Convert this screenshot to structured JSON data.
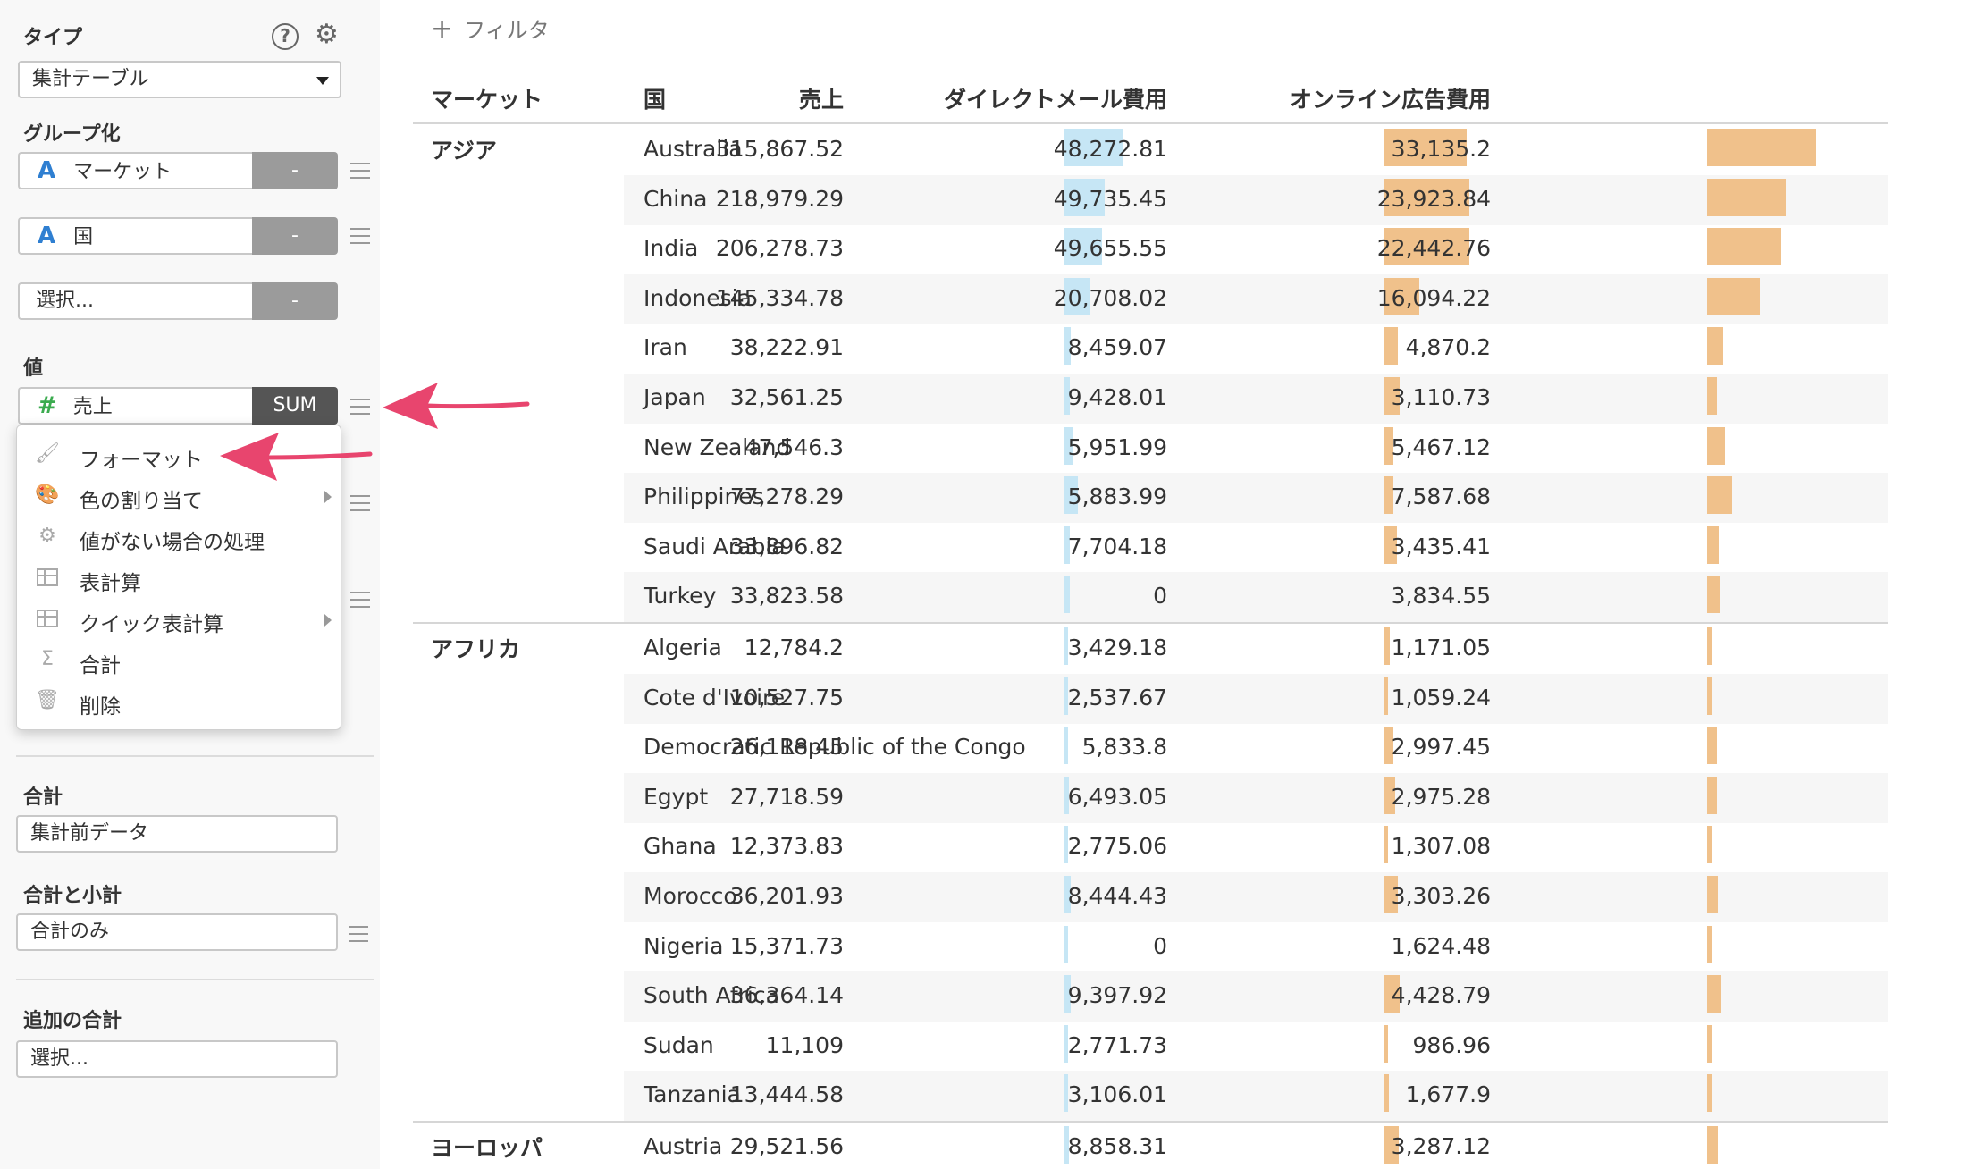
{
  "sidebar": {
    "type_label": "タイプ",
    "help_icon": "?",
    "type_select": "集計テーブル",
    "group_label": "グループ化",
    "group_fields": [
      {
        "type": "A",
        "name": "マーケット",
        "agg": "-"
      },
      {
        "type": "A",
        "name": "国",
        "agg": "-"
      },
      {
        "type": "",
        "name": "選択...",
        "agg": "-"
      }
    ],
    "value_label": "値",
    "value_field": {
      "type": "#",
      "name": "売上",
      "agg": "SUM"
    },
    "context_menu": [
      {
        "icon": "brush-icon",
        "label": "フォーマット",
        "submenu": false
      },
      {
        "icon": "palette-icon",
        "label": "色の割り当て",
        "submenu": true
      },
      {
        "icon": "gear-icon",
        "label": "値がない場合の処理",
        "submenu": false
      },
      {
        "icon": "table-icon",
        "label": "表計算",
        "submenu": false
      },
      {
        "icon": "table-icon",
        "label": "クイック表計算",
        "submenu": true
      },
      {
        "icon": "sigma-icon",
        "label": "合計",
        "submenu": false
      },
      {
        "icon": "trash-icon",
        "label": "削除",
        "submenu": false
      }
    ],
    "total_label": "合計",
    "total_select": "集計前データ",
    "subtotal_label": "合計と小計",
    "subtotal_select": "合計のみ",
    "extra_total_label": "追加の合計",
    "extra_total_select": "選択..."
  },
  "main": {
    "filter_plus": "+",
    "filter_label": "フィルタ",
    "headers": {
      "market": "マーケット",
      "country": "国",
      "sales": "売上",
      "dm_cost": "ダイレクトメール費用",
      "online_cost": "オンライン広告費用"
    },
    "bar_colors": {
      "sales": "#c6e6f5",
      "cost": "#f0c18b"
    },
    "bar_max": {
      "sales": 315867.52,
      "dm": 49735.45,
      "online": 33135.2
    },
    "groups": [
      {
        "market": "アジア",
        "rows": [
          {
            "country": "Australia",
            "sales": "315,867.52",
            "sales_v": 315867.52,
            "dm": "48,272.81",
            "dm_v": 48272.81,
            "online": "33,135.2",
            "online_v": 33135.2
          },
          {
            "country": "China",
            "sales": "218,979.29",
            "sales_v": 218979.29,
            "dm": "49,735.45",
            "dm_v": 49735.45,
            "online": "23,923.84",
            "online_v": 23923.84
          },
          {
            "country": "India",
            "sales": "206,278.73",
            "sales_v": 206278.73,
            "dm": "49,655.55",
            "dm_v": 49655.55,
            "online": "22,442.76",
            "online_v": 22442.76
          },
          {
            "country": "Indonesia",
            "sales": "145,334.78",
            "sales_v": 145334.78,
            "dm": "20,708.02",
            "dm_v": 20708.02,
            "online": "16,094.22",
            "online_v": 16094.22
          },
          {
            "country": "Iran",
            "sales": "38,222.91",
            "sales_v": 38222.91,
            "dm": "8,459.07",
            "dm_v": 8459.07,
            "online": "4,870.2",
            "online_v": 4870.2
          },
          {
            "country": "Japan",
            "sales": "32,561.25",
            "sales_v": 32561.25,
            "dm": "9,428.01",
            "dm_v": 9428.01,
            "online": "3,110.73",
            "online_v": 3110.73
          },
          {
            "country": "New Zealand",
            "sales": "47,546.3",
            "sales_v": 47546.3,
            "dm": "5,951.99",
            "dm_v": 5951.99,
            "online": "5,467.12",
            "online_v": 5467.12
          },
          {
            "country": "Philippines",
            "sales": "77,278.29",
            "sales_v": 77278.29,
            "dm": "5,883.99",
            "dm_v": 5883.99,
            "online": "7,587.68",
            "online_v": 7587.68
          },
          {
            "country": "Saudi Arabia",
            "sales": "33,896.82",
            "sales_v": 33896.82,
            "dm": "7,704.18",
            "dm_v": 7704.18,
            "online": "3,435.41",
            "online_v": 3435.41
          },
          {
            "country": "Turkey",
            "sales": "33,823.58",
            "sales_v": 33823.58,
            "dm": "0",
            "dm_v": 0,
            "online": "3,834.55",
            "online_v": 3834.55
          }
        ]
      },
      {
        "market": "アフリカ",
        "rows": [
          {
            "country": "Algeria",
            "sales": "12,784.2",
            "sales_v": 12784.2,
            "dm": "3,429.18",
            "dm_v": 3429.18,
            "online": "1,171.05",
            "online_v": 1171.05
          },
          {
            "country": "Cote d'Ivoire",
            "sales": "10,527.75",
            "sales_v": 10527.75,
            "dm": "2,537.67",
            "dm_v": 2537.67,
            "online": "1,059.24",
            "online_v": 1059.24
          },
          {
            "country": "Democratic Republic of the Congo",
            "sales": "26,118.45",
            "sales_v": 26118.45,
            "dm": "5,833.8",
            "dm_v": 5833.8,
            "online": "2,997.45",
            "online_v": 2997.45
          },
          {
            "country": "Egypt",
            "sales": "27,718.59",
            "sales_v": 27718.59,
            "dm": "6,493.05",
            "dm_v": 6493.05,
            "online": "2,975.28",
            "online_v": 2975.28
          },
          {
            "country": "Ghana",
            "sales": "12,373.83",
            "sales_v": 12373.83,
            "dm": "2,775.06",
            "dm_v": 2775.06,
            "online": "1,307.08",
            "online_v": 1307.08
          },
          {
            "country": "Morocco",
            "sales": "36,201.93",
            "sales_v": 36201.93,
            "dm": "8,444.43",
            "dm_v": 8444.43,
            "online": "3,303.26",
            "online_v": 3303.26
          },
          {
            "country": "Nigeria",
            "sales": "15,371.73",
            "sales_v": 15371.73,
            "dm": "0",
            "dm_v": 0,
            "online": "1,624.48",
            "online_v": 1624.48
          },
          {
            "country": "South Africa",
            "sales": "36,364.14",
            "sales_v": 36364.14,
            "dm": "9,397.92",
            "dm_v": 9397.92,
            "online": "4,428.79",
            "online_v": 4428.79
          },
          {
            "country": "Sudan",
            "sales": "11,109",
            "sales_v": 11109,
            "dm": "2,771.73",
            "dm_v": 2771.73,
            "online": "986.96",
            "online_v": 986.96
          },
          {
            "country": "Tanzania",
            "sales": "13,444.58",
            "sales_v": 13444.58,
            "dm": "3,106.01",
            "dm_v": 3106.01,
            "online": "1,677.9",
            "online_v": 1677.9
          }
        ]
      },
      {
        "market": "ヨーロッパ",
        "rows": [
          {
            "country": "Austria",
            "sales": "29,521.56",
            "sales_v": 29521.56,
            "dm": "8,858.31",
            "dm_v": 8858.31,
            "online": "3,287.12",
            "online_v": 3287.12
          }
        ]
      }
    ]
  }
}
